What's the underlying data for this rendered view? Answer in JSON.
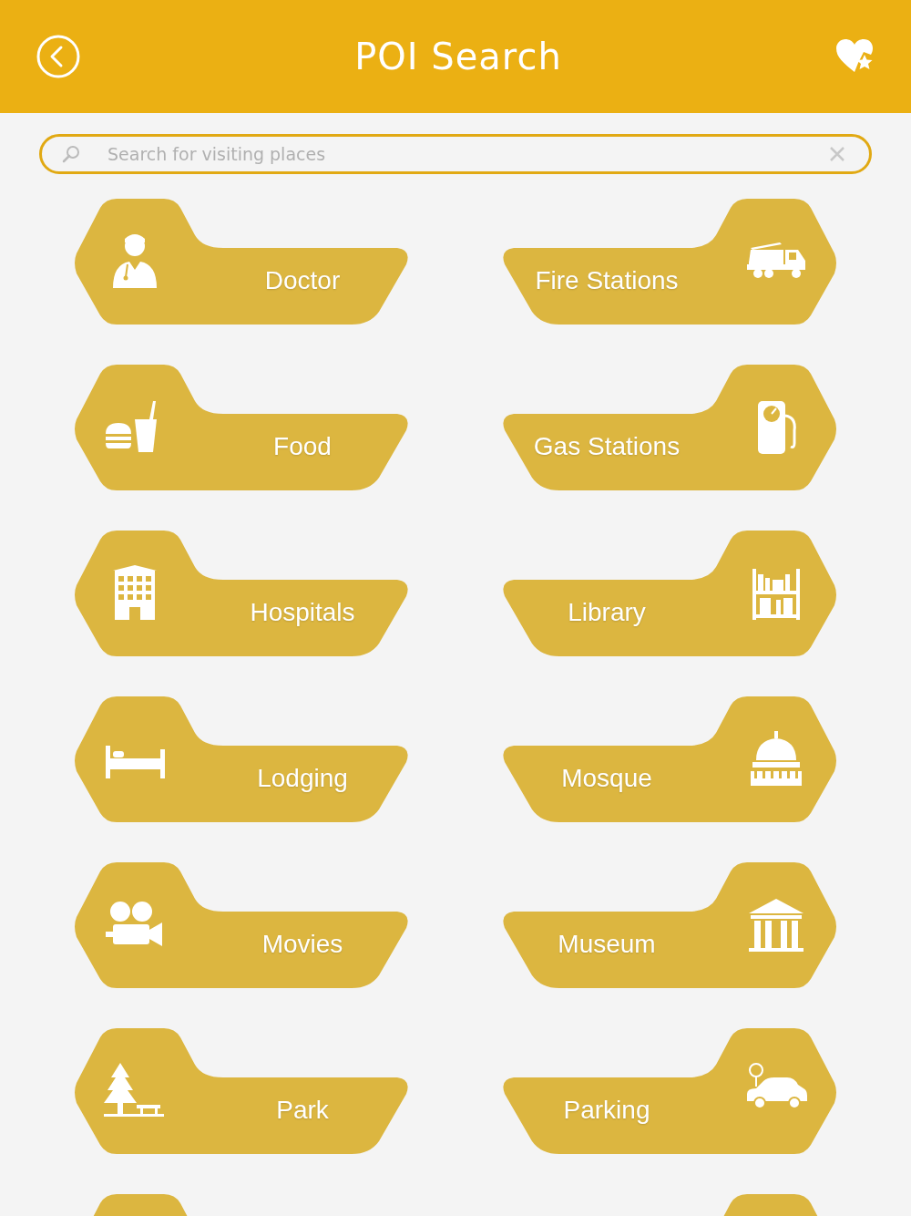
{
  "header": {
    "title": "POI Search"
  },
  "search": {
    "placeholder": "Search for visiting places"
  },
  "categories": [
    {
      "label": "Doctor"
    },
    {
      "label": "Fire Stations"
    },
    {
      "label": "Food"
    },
    {
      "label": "Gas Stations"
    },
    {
      "label": "Hospitals"
    },
    {
      "label": "Library"
    },
    {
      "label": "Lodging"
    },
    {
      "label": "Mosque"
    },
    {
      "label": "Movies"
    },
    {
      "label": "Museum"
    },
    {
      "label": "Park"
    },
    {
      "label": "Parking"
    }
  ],
  "more_below": true
}
